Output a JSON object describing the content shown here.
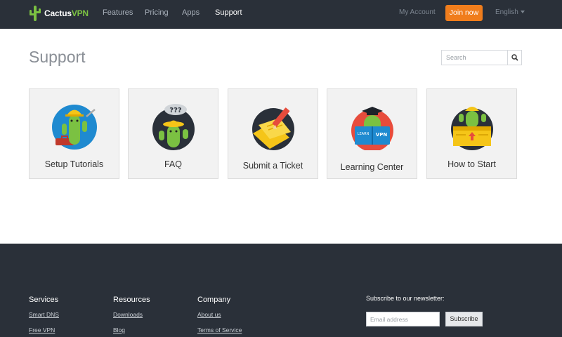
{
  "header": {
    "logo_word1": "Cactus",
    "logo_word2": "VPN",
    "nav": [
      "Features",
      "Pricing",
      "Apps",
      "Support"
    ],
    "my_account": "My Account",
    "join_label": "Join now",
    "language": "English"
  },
  "main": {
    "title": "Support",
    "search_placeholder": "Search",
    "cards": [
      {
        "label": "Setup Tutorials",
        "icon": "worker-cactus-icon"
      },
      {
        "label": "FAQ",
        "icon": "question-cactus-icon"
      },
      {
        "label": "Submit a Ticket",
        "icon": "ticket-pencil-icon"
      },
      {
        "label": "Learning Center",
        "icon": "learning-cactus-icon"
      },
      {
        "label": "How to Start",
        "icon": "box-cactus-icon"
      }
    ]
  },
  "footer": {
    "services": {
      "heading": "Services",
      "links": [
        "Smart DNS",
        "Free VPN"
      ]
    },
    "resources": {
      "heading": "Resources",
      "links": [
        "Downloads",
        "Blog"
      ]
    },
    "company": {
      "heading": "Company",
      "links": [
        "About us",
        "Terms of Service"
      ]
    },
    "newsletter": {
      "title": "Subscribe to our newsletter:",
      "placeholder": "Email address",
      "button": "Subscribe"
    }
  },
  "colors": {
    "brand_green": "#7bc142",
    "accent_orange": "#f07d1c",
    "header_bg": "#2a3039"
  }
}
